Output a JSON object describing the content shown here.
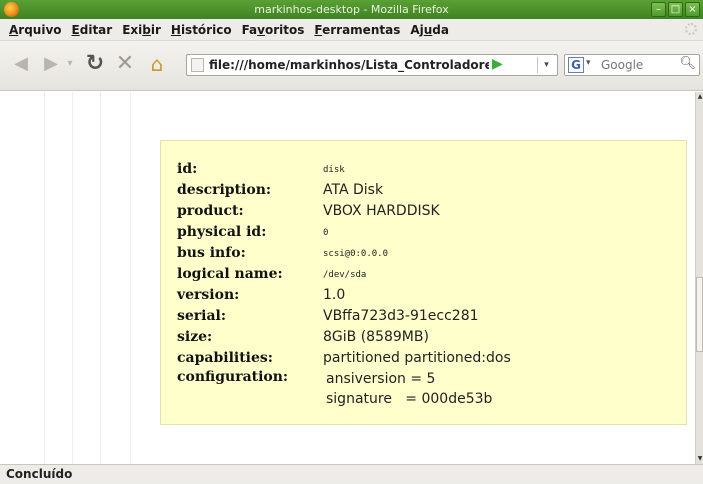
{
  "window": {
    "title": "markinhos-desktop - Mozilla Firefox",
    "buttons": {
      "minimize": "–",
      "maximize": "□",
      "close": "×"
    }
  },
  "menubar": {
    "items": [
      {
        "label": "Arquivo",
        "accel": "A"
      },
      {
        "label": "Editar",
        "accel": "E"
      },
      {
        "label": "Exibir",
        "accel": "b"
      },
      {
        "label": "Histórico",
        "accel": "H"
      },
      {
        "label": "Favoritos",
        "accel": "v"
      },
      {
        "label": "Ferramentas",
        "accel": "F"
      },
      {
        "label": "Ajuda",
        "accel": "u"
      }
    ]
  },
  "toolbar": {
    "back_icon": "back-arrow-icon",
    "forward_icon": "forward-arrow-icon",
    "url": "file:///home/markinhos/Lista_Controladores_Si",
    "search_placeholder": "Google"
  },
  "device": {
    "rows": [
      {
        "key": "id:",
        "value": "disk",
        "mono": true
      },
      {
        "key": "description:",
        "value": "ATA Disk",
        "mono": false
      },
      {
        "key": "product:",
        "value": "VBOX HARDDISK",
        "mono": false
      },
      {
        "key": "physical id:",
        "value": "0",
        "mono": true
      },
      {
        "key": "bus info:",
        "value": "scsi@0:0.0.0",
        "mono": true
      },
      {
        "key": "logical name:",
        "value": "/dev/sda",
        "mono": true
      },
      {
        "key": "version:",
        "value": "1.0",
        "mono": false
      },
      {
        "key": "serial:",
        "value": "VBffa723d3-91ecc281",
        "mono": false
      },
      {
        "key": "size:",
        "value": "8GiB (8589MB)",
        "mono": false
      },
      {
        "key": "capabilities:",
        "value": "partitioned partitioned:dos",
        "mono": false
      }
    ],
    "configuration": {
      "key": "configuration:",
      "lines": [
        "ansiversion = 5",
        "signature   = 000de53b"
      ]
    }
  },
  "status": {
    "text": "Concluído"
  },
  "colors": {
    "info_bg": "#ffffcc",
    "titlebar": "#4a8f2a"
  }
}
